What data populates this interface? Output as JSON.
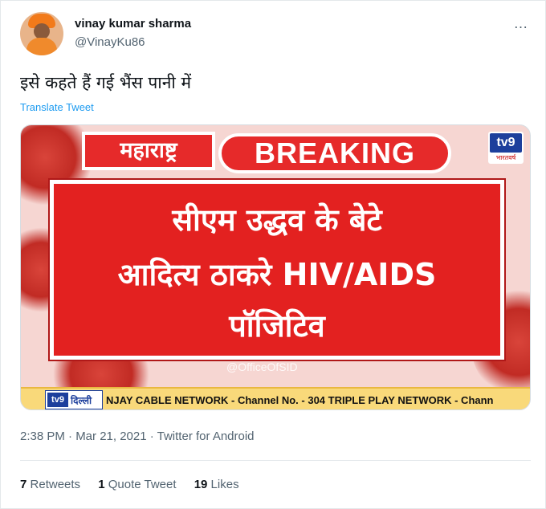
{
  "user": {
    "name": "vinay kumar sharma",
    "handle": "@VinayKu86"
  },
  "more_icon": "…",
  "tweet": {
    "text": "इसे कहते हैं गई भैंस पानी में",
    "translate_label": "Translate Tweet"
  },
  "media": {
    "state_label": "महाराष्ट्र",
    "breaking_label": "BREAKING",
    "logo": {
      "main": "tv9",
      "sub": "भारतवर्ष"
    },
    "headline": [
      "सीएम उद्धव के बेटे",
      "आदित्य ठाकरे HIV/AIDS",
      "पॉजिटिव"
    ],
    "watermark": "@OfficeOfSID",
    "ticker": {
      "logo_main": "tv9",
      "logo_city": "दिल्ली",
      "text": "NJAY CABLE NETWORK - Channel No. - 304  TRIPLE PLAY NETWORK - Chann"
    }
  },
  "meta": "2:38 PM · Mar 21, 2021 · Twitter for Android",
  "stats": {
    "retweets": {
      "count": "7",
      "label": "Retweets"
    },
    "quotes": {
      "count": "1",
      "label": "Quote Tweet"
    },
    "likes": {
      "count": "19",
      "label": "Likes"
    }
  },
  "colors": {
    "link": "#1d9bf0",
    "secondary_text": "#536471",
    "breaking_red": "#e32120",
    "ticker_yellow": "#f9d97a",
    "tv9_blue": "#1d3f9c"
  }
}
